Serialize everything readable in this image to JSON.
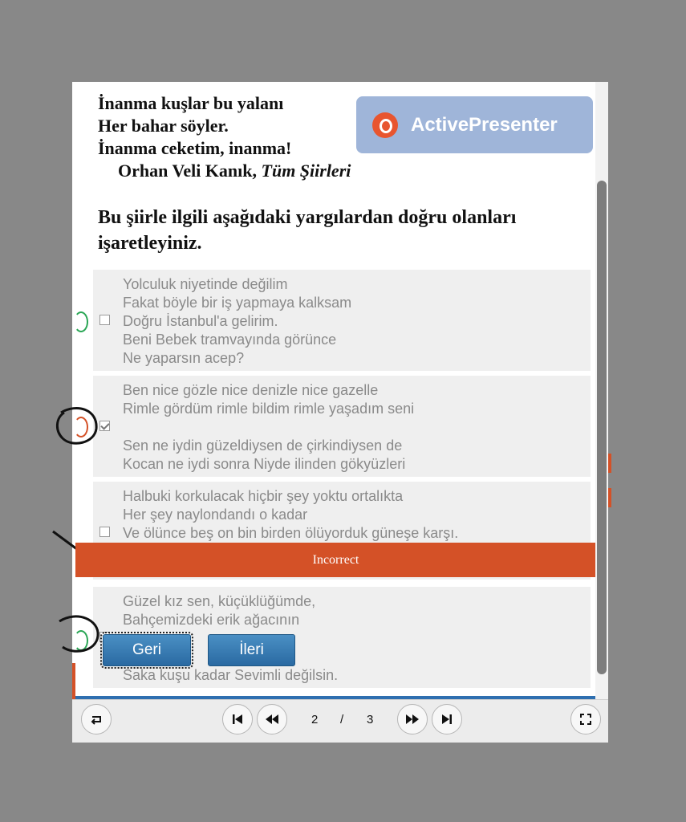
{
  "poem": {
    "lines": [
      "İnanma kuşlar bu yalanı",
      "Her bahar söyler.",
      "İnanma ceketim, inanma!"
    ],
    "author": "Orhan Veli Kanık,",
    "book": "Tüm Şiirleri"
  },
  "logo": {
    "name": "ActivePresenter"
  },
  "question": "Bu şiirle ilgili aşağıdaki yargılardan doğru olanları işaretleyiniz.",
  "options": [
    {
      "text": "Yolculuk niyetinde değilim\nFakat böyle bir iş yapmaya kalksam\nDoğru İstanbul'a gelirim.\nBeni Bebek tramvayında görünce\nNe yaparsın acep?",
      "checked": false
    },
    {
      "text": "Ben nice gözle nice denizle nice gazelle\nRimle gördüm rimle bildim rimle yaşadım seni\n\nSen ne iydin güzeldiysen de çirkindiysen de\nKocan ne iydi sonra Niyde ilinden gökyüzleri",
      "checked": true
    },
    {
      "text": "Halbuki korkulacak hiçbir şey yoktu ortalıkta\nHer şey naylondandı o kadar\nVe ölünce beş on bin birden ölüyorduk güneşe karşı.",
      "checked": false
    },
    {
      "text": "Güzel kız sen, küçüklüğümde,\nBahçemizdeki erik ağacının\n\n\nSaka kuşu kadar Sevimli değilsin.",
      "checked": false
    }
  ],
  "feedback": "Incorrect",
  "buttons": {
    "back": "Geri",
    "next": "İleri"
  },
  "pagination": {
    "current": "2",
    "separator": "/",
    "total": "3"
  },
  "icons": [
    "replay-icon",
    "first-slide-icon",
    "rewind-icon",
    "forward-icon",
    "last-slide-icon",
    "fullscreen-icon"
  ],
  "colors": {
    "feedback_bg": "#d45127",
    "button_blue": "#2e6fb0",
    "logo_bg": "#9fb5d9"
  }
}
